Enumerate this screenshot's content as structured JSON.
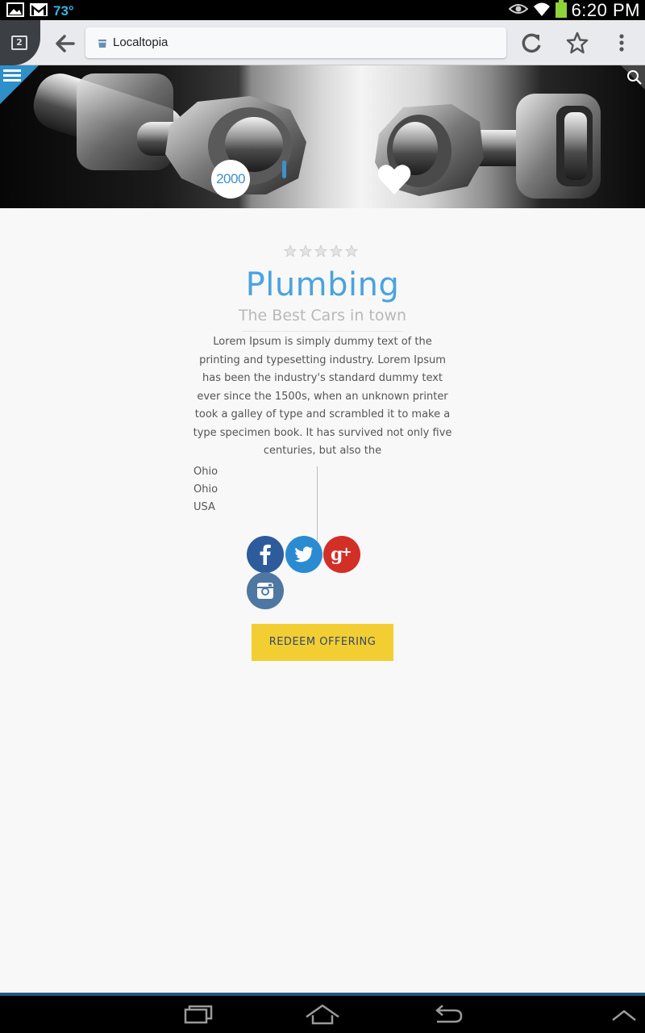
{
  "status_bar": {
    "temperature": "73°",
    "time": "6:20 PM",
    "icons": [
      "gallery-icon",
      "gmail-icon",
      "eye-icon",
      "wifi-icon",
      "battery-icon"
    ]
  },
  "browser": {
    "tab_count": "2",
    "url": "Localtopia",
    "icons": [
      "back-arrow-icon",
      "reload-icon",
      "star-icon",
      "overflow-menu-icon"
    ]
  },
  "hero": {
    "count": "2000",
    "icons": [
      "hamburger-icon",
      "search-icon",
      "heart-icon"
    ]
  },
  "listing": {
    "rating_stars": 5,
    "rating_value": 0,
    "title": "Plumbing",
    "subtitle": "The Best Cars in town",
    "description": "Lorem Ipsum is simply dummy text of the printing and typesetting industry. Lorem Ipsum has been the industry's standard dummy text ever since the 1500s, when an unknown printer took a galley of type and scrambled it to make a type specimen book. It has survived not only five centuries, but also the",
    "address": {
      "line1": "Ohio",
      "line2": "Ohio",
      "line3": "USA"
    },
    "social": [
      "facebook-icon",
      "twitter-icon",
      "google-plus-icon",
      "instagram-icon"
    ],
    "cta_label": "REDEEM OFFERING"
  },
  "colors": {
    "accent_blue": "#4aa3df",
    "cta_yellow": "#f3ce33",
    "facebook": "#2d5b9b",
    "twitter": "#2b8bd0",
    "google_plus": "#d22f27",
    "instagram": "#4e77a2"
  },
  "nav_bar": {
    "icons": [
      "recent-apps-icon",
      "home-icon",
      "back-icon",
      "chevron-up-icon"
    ]
  }
}
